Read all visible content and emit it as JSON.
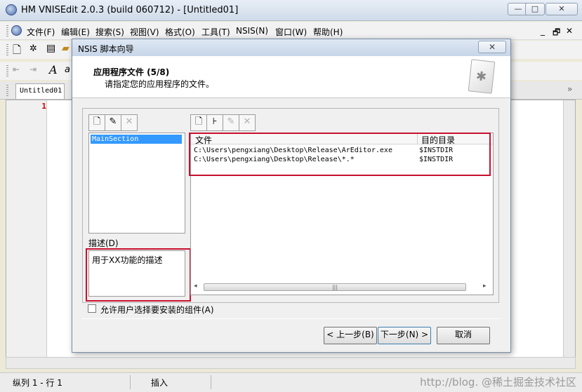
{
  "window": {
    "title": "HM VNISEdit 2.0.3 (build 060712) - [Untitled01]",
    "controls": {
      "minimize": "—",
      "maximize": "□",
      "close": "✕"
    }
  },
  "menu": {
    "items": [
      "文件(F)",
      "编辑(E)",
      "搜索(S)",
      "视图(V)",
      "格式(O)",
      "工具(T)",
      "NSIS(N)",
      "窗口(W)",
      "帮助(H)"
    ],
    "mdi_controls": [
      "_",
      "🗗",
      "✕"
    ]
  },
  "tabs": {
    "document": "Untitled01",
    "scroll_hint": "»"
  },
  "editor": {
    "line_number": "1"
  },
  "status": {
    "position": "纵列 1 - 行 1",
    "mode": "插入",
    "watermark": "http://blog. @稀土掘金技术社区"
  },
  "dialog": {
    "title": "NSIS 脚本向导",
    "close": "✕",
    "header_title": "应用程序文件 (5/8)",
    "header_subtitle": "请指定您的应用程序的文件。",
    "sections": [
      "MainSection"
    ],
    "description_label": "描述(D)",
    "description_text": "用于XX功能的描述",
    "files_columns": [
      "文件",
      "目的目录"
    ],
    "files": [
      {
        "file": "C:\\Users\\pengxiang\\Desktop\\Release\\ArEditor.exe",
        "dest": "$INSTDIR"
      },
      {
        "file": "C:\\Users\\pengxiang\\Desktop\\Release\\*.*",
        "dest": "$INSTDIR"
      }
    ],
    "checkbox_label": "允许用户选择要安装的组件(A)",
    "buttons": {
      "back": "< 上一步(B)",
      "next": "下一步(N) >",
      "cancel": "取消"
    }
  }
}
